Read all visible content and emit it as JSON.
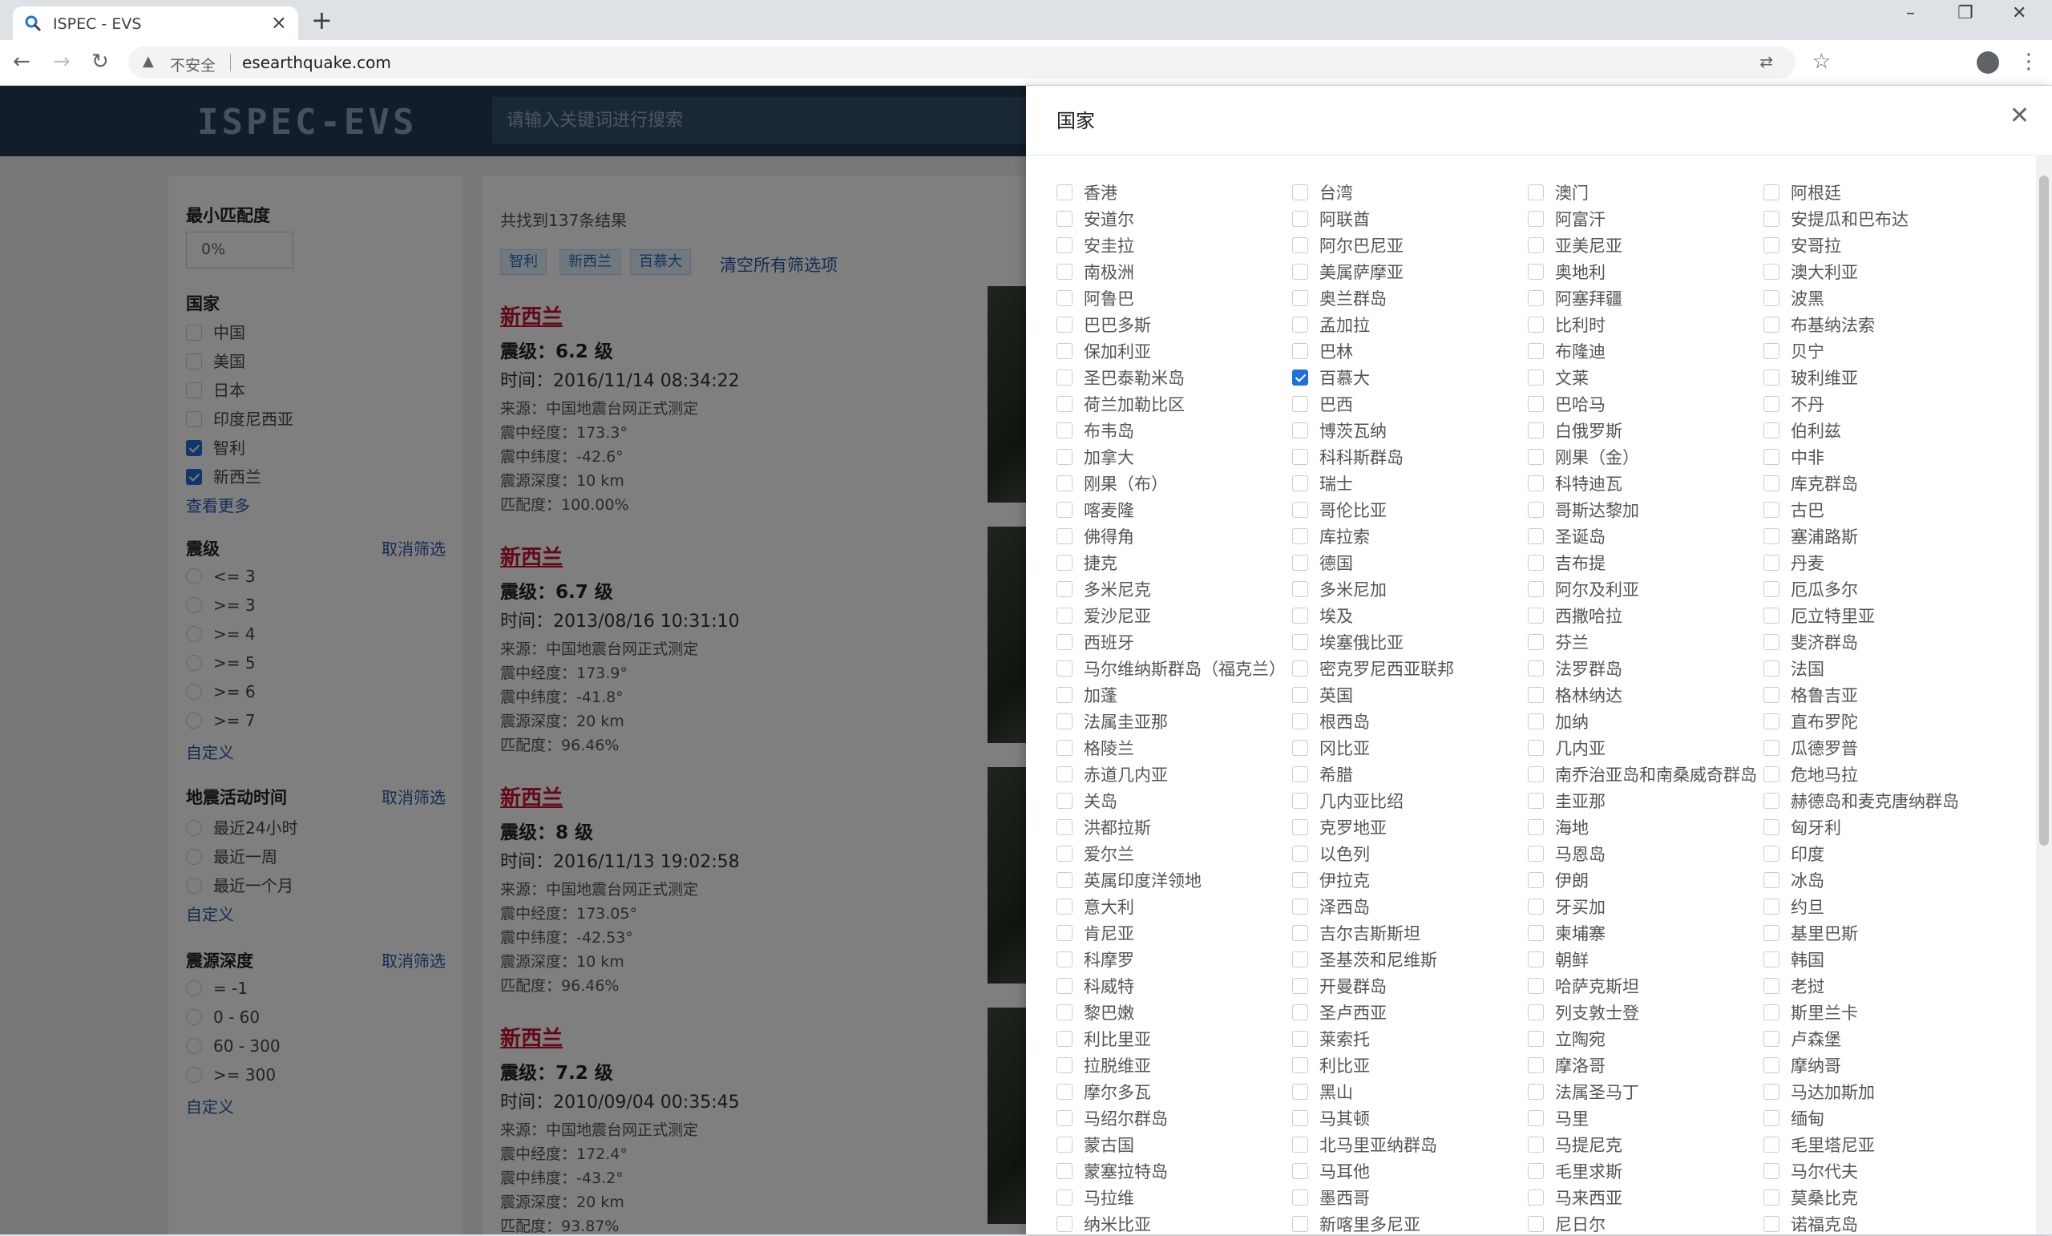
{
  "browser": {
    "tab_title": "ISPEC - EVS",
    "new_tab": "+",
    "insecure_label": "不安全",
    "url": "esearthquake.com"
  },
  "site": {
    "logo": "ISPEC-EVS",
    "search_placeholder": "请输入关键词进行搜索"
  },
  "sidebar": {
    "min_match": {
      "title": "最小匹配度",
      "value": "0%"
    },
    "country": {
      "title": "国家",
      "items": [
        {
          "label": "中国",
          "checked": false
        },
        {
          "label": "美国",
          "checked": false
        },
        {
          "label": "日本",
          "checked": false
        },
        {
          "label": "印度尼西亚",
          "checked": false
        },
        {
          "label": "智利",
          "checked": true
        },
        {
          "label": "新西兰",
          "checked": true
        }
      ],
      "more": "查看更多"
    },
    "magnitude": {
      "title": "震级",
      "cancel": "取消筛选",
      "items": [
        "<= 3",
        ">= 3",
        ">= 4",
        ">= 5",
        ">= 6",
        ">= 7"
      ],
      "custom": "自定义"
    },
    "time": {
      "title": "地震活动时间",
      "cancel": "取消筛选",
      "items": [
        "最近24小时",
        "最近一周",
        "最近一个月"
      ],
      "custom": "自定义"
    },
    "depth": {
      "title": "震源深度",
      "cancel": "取消筛选",
      "items": [
        "= -1",
        "0 - 60",
        "60 - 300",
        ">= 300"
      ],
      "custom": "自定义"
    }
  },
  "results": {
    "count_text": "共找到137条结果",
    "chips": [
      "智利",
      "新西兰",
      "百慕大"
    ],
    "clear_all": "清空所有筛选项",
    "cards": [
      {
        "place": "新西兰",
        "magnitude": "震级：6.2 级",
        "time": "时间：2016/11/14 08:34:22",
        "source": "来源：中国地震台网正式测定",
        "lon": "震中经度：173.3°",
        "lat": "震中纬度：-42.6°",
        "depth": "震源深度：10 km",
        "match": "匹配度：100.00%"
      },
      {
        "place": "新西兰",
        "magnitude": "震级：6.7 级",
        "time": "时间：2013/08/16 10:31:10",
        "source": "来源：中国地震台网正式测定",
        "lon": "震中经度：173.9°",
        "lat": "震中纬度：-41.8°",
        "depth": "震源深度：20 km",
        "match": "匹配度：96.46%"
      },
      {
        "place": "新西兰",
        "magnitude": "震级：8 级",
        "time": "时间：2016/11/13 19:02:58",
        "source": "来源：中国地震台网正式测定",
        "lon": "震中经度：173.05°",
        "lat": "震中纬度：-42.53°",
        "depth": "震源深度：10 km",
        "match": "匹配度：96.46%"
      },
      {
        "place": "新西兰",
        "magnitude": "震级：7.2 级",
        "time": "时间：2010/09/04 00:35:45",
        "source": "来源：中国地震台网正式测定",
        "lon": "震中经度：172.4°",
        "lat": "震中纬度：-43.2°",
        "depth": "震源深度：20 km",
        "match": "匹配度：93.87%"
      }
    ]
  },
  "drawer": {
    "title": "国家",
    "columns": [
      [
        "香港",
        "安道尔",
        "安圭拉",
        "南极洲",
        "阿鲁巴",
        "巴巴多斯",
        "保加利亚",
        "圣巴泰勒米岛",
        "荷兰加勒比区",
        "布韦岛",
        "加拿大",
        "刚果（布）",
        "喀麦隆",
        "佛得角",
        "捷克",
        "多米尼克",
        "爱沙尼亚",
        "西班牙",
        "马尔维纳斯群岛（福克兰）",
        "加蓬",
        "法属圭亚那",
        "格陵兰",
        "赤道几内亚",
        "关岛",
        "洪都拉斯",
        "爱尔兰",
        "英属印度洋领地",
        "意大利",
        "肯尼亚",
        "科摩罗",
        "科威特",
        "黎巴嫩",
        "利比里亚",
        "拉脱维亚",
        "摩尔多瓦",
        "马绍尔群岛",
        "蒙古国",
        "蒙塞拉特岛",
        "马拉维",
        "纳米比亚"
      ],
      [
        "台湾",
        "阿联酋",
        "阿尔巴尼亚",
        "美属萨摩亚",
        "奥兰群岛",
        "孟加拉",
        "巴林",
        "百慕大",
        "巴西",
        "博茨瓦纳",
        "科科斯群岛",
        "瑞士",
        "哥伦比亚",
        "库拉索",
        "德国",
        "多米尼加",
        "埃及",
        "埃塞俄比亚",
        "密克罗尼西亚联邦",
        "英国",
        "根西岛",
        "冈比亚",
        "希腊",
        "几内亚比绍",
        "克罗地亚",
        "以色列",
        "伊拉克",
        "泽西岛",
        "吉尔吉斯斯坦",
        "圣基茨和尼维斯",
        "开曼群岛",
        "圣卢西亚",
        "莱索托",
        "利比亚",
        "黑山",
        "马其顿",
        "北马里亚纳群岛",
        "马耳他",
        "墨西哥",
        "新喀里多尼亚"
      ],
      [
        "澳门",
        "阿富汗",
        "亚美尼亚",
        "奥地利",
        "阿塞拜疆",
        "比利时",
        "布隆迪",
        "文莱",
        "巴哈马",
        "白俄罗斯",
        "刚果（金）",
        "科特迪瓦",
        "哥斯达黎加",
        "圣诞岛",
        "吉布提",
        "阿尔及利亚",
        "西撒哈拉",
        "芬兰",
        "法罗群岛",
        "格林纳达",
        "加纳",
        "几内亚",
        "南乔治亚岛和南桑威奇群岛",
        "圭亚那",
        "海地",
        "马恩岛",
        "伊朗",
        "牙买加",
        "柬埔寨",
        "朝鲜",
        "哈萨克斯坦",
        "列支敦士登",
        "立陶宛",
        "摩洛哥",
        "法属圣马丁",
        "马里",
        "马提尼克",
        "毛里求斯",
        "马来西亚",
        "尼日尔"
      ],
      [
        "阿根廷",
        "安提瓜和巴布达",
        "安哥拉",
        "澳大利亚",
        "波黑",
        "布基纳法索",
        "贝宁",
        "玻利维亚",
        "不丹",
        "伯利兹",
        "中非",
        "库克群岛",
        "古巴",
        "塞浦路斯",
        "丹麦",
        "厄瓜多尔",
        "厄立特里亚",
        "斐济群岛",
        "法国",
        "格鲁吉亚",
        "直布罗陀",
        "瓜德罗普",
        "危地马拉",
        "赫德岛和麦克唐纳群岛",
        "匈牙利",
        "印度",
        "冰岛",
        "约旦",
        "基里巴斯",
        "韩国",
        "老挝",
        "斯里兰卡",
        "卢森堡",
        "摩纳哥",
        "马达加斯加",
        "缅甸",
        "毛里塔尼亚",
        "马尔代夫",
        "莫桑比克",
        "诺福克岛"
      ]
    ],
    "checked": [
      "百慕大"
    ]
  }
}
